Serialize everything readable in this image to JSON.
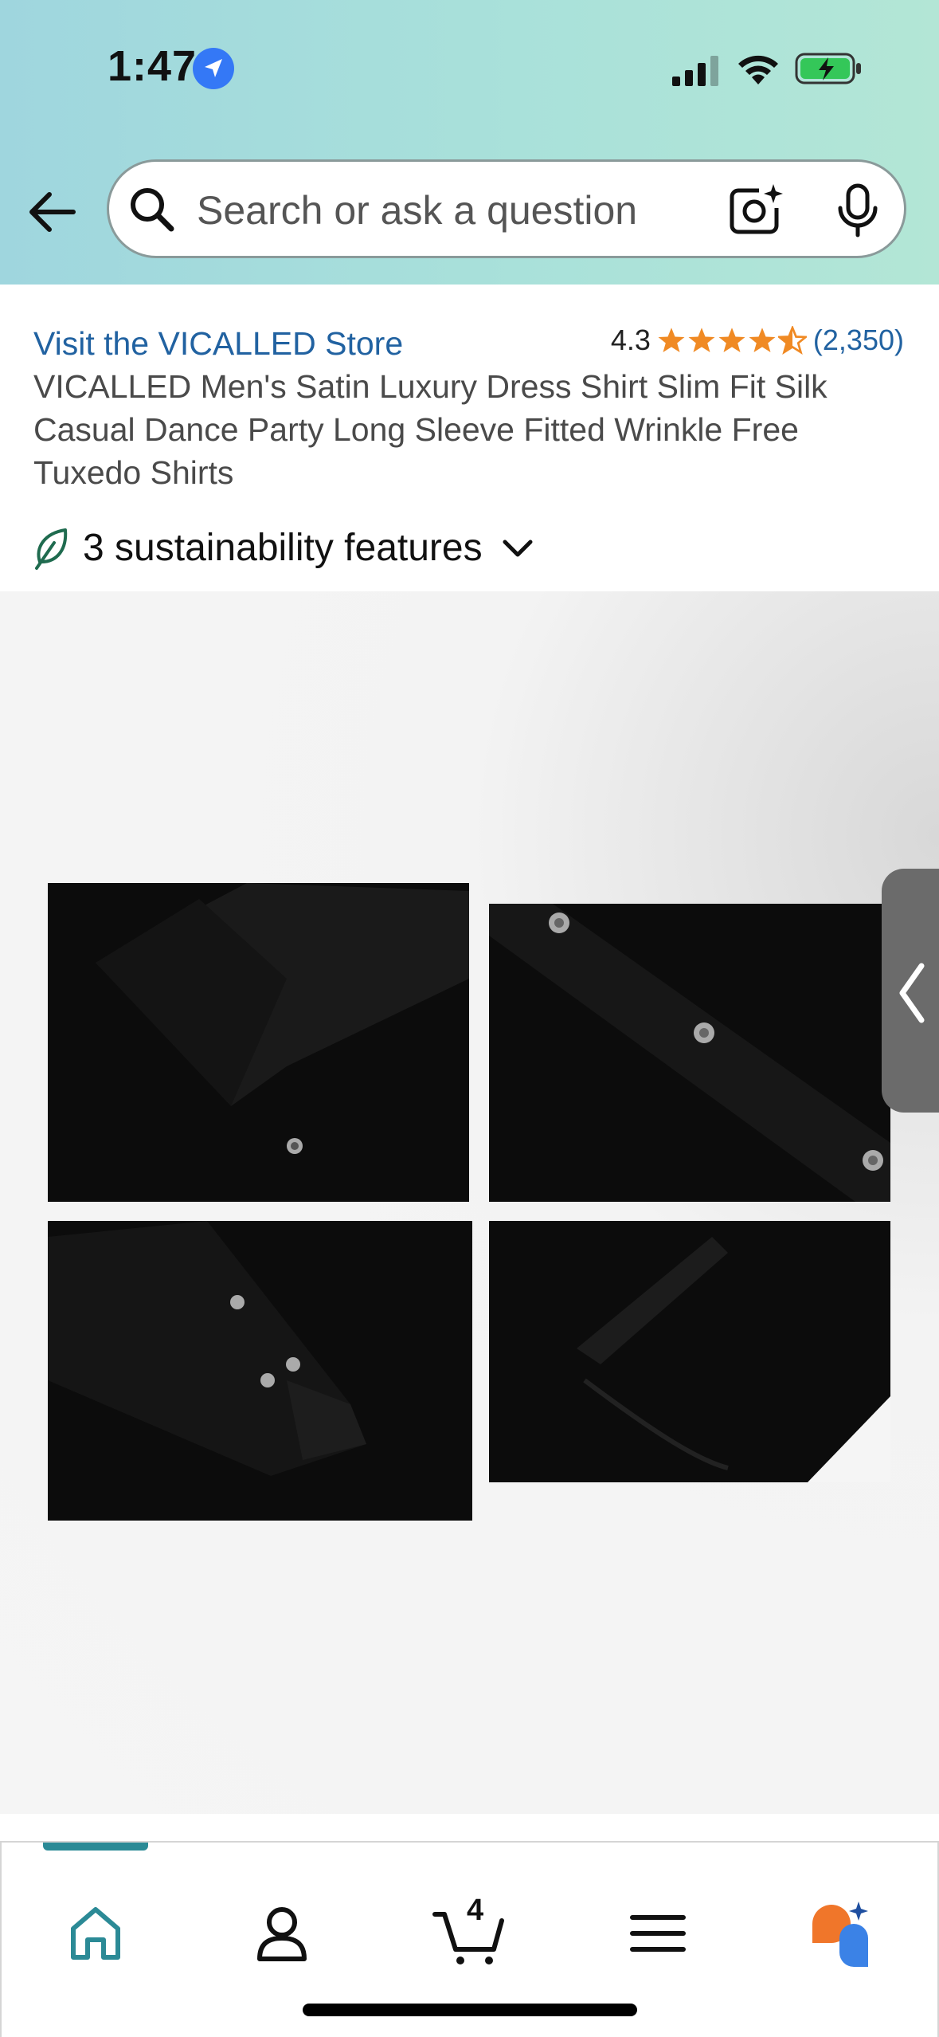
{
  "status_bar": {
    "time": "1:47",
    "icons": [
      "location-arrow-icon",
      "signal-icon",
      "wifi-icon",
      "battery-charging-icon"
    ]
  },
  "search": {
    "placeholder": "Search or ask a question",
    "icons": [
      "back-arrow-icon",
      "search-icon",
      "camera-icon",
      "mic-icon"
    ]
  },
  "product": {
    "store_link": "Visit the VICALLED Store",
    "rating_value": "4.3",
    "rating_count": "(2,350)",
    "title": "VICALLED Men's Satin Luxury Dress Shirt Slim Fit Silk Casual Dance Party Long Sleeve Fitted Wrinkle Free Tuxedo Shirts",
    "sustainability": "3 sustainability features"
  },
  "gallery": {
    "images": [
      "shirt-collar-image",
      "shirt-buttons-image",
      "shirt-cuff-image",
      "shirt-hem-image"
    ]
  },
  "bottom_nav": {
    "cart_count": "4",
    "items": [
      "home-icon",
      "account-icon",
      "cart-icon",
      "menu-icon",
      "rufus-icon"
    ]
  },
  "colors": {
    "header_gradient_start": "#9fd6de",
    "header_gradient_end": "#b3e6d6",
    "link_blue": "#2162a1",
    "star_orange": "#f08a24",
    "nav_accent": "#2b8a96"
  }
}
